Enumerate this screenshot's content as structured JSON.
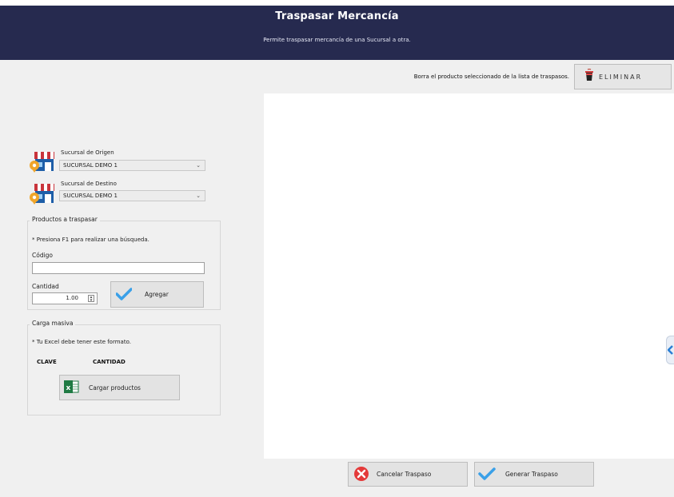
{
  "header": {
    "title": "Traspasar Mercancía",
    "subtitle": "Permite traspasar mercancía de una Sucursal a otra."
  },
  "toolbar": {
    "delete_hint": "Borra el producto seleccionado de la lista de traspasos.",
    "delete_label": "ELIMINAR"
  },
  "origin": {
    "label": "Sucursal de Origen",
    "selected": "SUCURSAL DEMO 1"
  },
  "destination": {
    "label": "Sucursal de Destino",
    "selected": "SUCURSAL DEMO 1"
  },
  "products": {
    "group_title": "Productos a traspasar",
    "hint": "* Presiona F1 para realizar una búsqueda.",
    "code_label": "Código",
    "code_value": "",
    "quantity_label": "Cantidad",
    "quantity_value": "1.00",
    "add_label": "Agregar"
  },
  "bulk": {
    "group_title": "Carga masiva",
    "hint": "* Tu Excel debe tener este formato.",
    "col_key": "CLAVE",
    "col_qty": "CANTIDAD",
    "load_label": "Cargar productos"
  },
  "footer": {
    "cancel_label": "Cancelar Traspaso",
    "generate_label": "Generar Traspaso"
  },
  "colors": {
    "header_bg": "#262a4f",
    "panel_bg": "#f0f0f0",
    "check_blue": "#3aa0e8",
    "cancel_red": "#e43a3a",
    "excel_green": "#1f7a43"
  },
  "icons": [
    "store-icon",
    "check-icon",
    "excel-icon",
    "cancel-icon",
    "trash-icon",
    "chevron-down-icon",
    "spinner-icon",
    "side-tab-arrow-icon"
  ]
}
